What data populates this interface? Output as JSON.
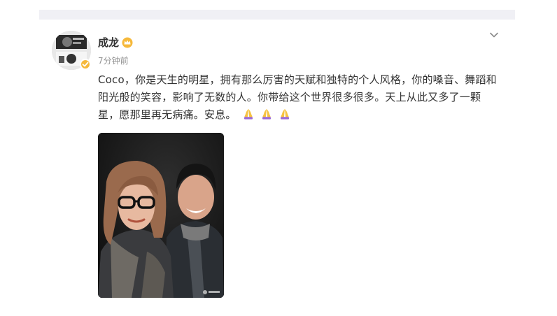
{
  "post": {
    "author": "成龙",
    "time": "7分钟前",
    "text": "Coco，你是天生的明星，拥有那么厉害的天赋和独特的个人风格，你的嗓音、舞蹈和阳光般的笑容，影响了无数的人。你带给这个世界很多很多。天上从此又多了一颗星，愿那里再无病痛。安息。",
    "emojis": [
      "pray",
      "pray",
      "pray"
    ],
    "icons": {
      "vip": "crown-badge-icon",
      "verified": "verified-badge-icon",
      "more": "chevron-down-icon",
      "emoji": "folded-hands-icon"
    }
  },
  "colors": {
    "text": "#333333",
    "muted": "#939393",
    "vip": "#f6b93b",
    "emoji": "#9b6bd6"
  }
}
